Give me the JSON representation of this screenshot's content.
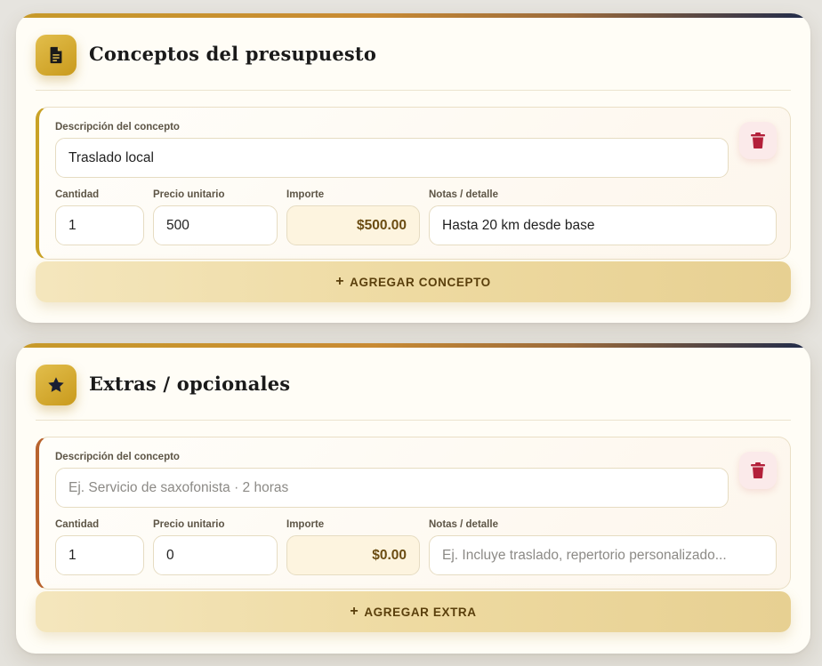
{
  "sections": [
    {
      "title": "Conceptos del presupuesto",
      "icon": "document-icon",
      "item": {
        "desc_label": "Descripción del concepto",
        "desc_value": "Traslado local",
        "desc_placeholder": "",
        "qty_label": "Cantidad",
        "qty_value": "1",
        "price_label": "Precio unitario",
        "price_value": "500",
        "amount_label": "Importe",
        "amount_value": "$500.00",
        "notes_label": "Notas / detalle",
        "notes_value": "Hasta 20 km desde base",
        "notes_placeholder": ""
      },
      "add_button": "AGREGAR CONCEPTO"
    },
    {
      "title": "Extras / opcionales",
      "icon": "star-icon",
      "item": {
        "desc_label": "Descripción del concepto",
        "desc_value": "",
        "desc_placeholder": "Ej. Servicio de saxofonista · 2 horas",
        "qty_label": "Cantidad",
        "qty_value": "1",
        "price_label": "Precio unitario",
        "price_value": "0",
        "amount_label": "Importe",
        "amount_value": "$0.00",
        "notes_label": "Notas / detalle",
        "notes_value": "",
        "notes_placeholder": "Ej. Incluye traslado, repertorio personalizado..."
      },
      "add_button": "AGREGAR EXTRA"
    }
  ],
  "colors": {
    "accent_gold": "#c9a227",
    "accent_copper": "#b8632e",
    "delete_red": "#b3203a",
    "navy": "#1f2a4a"
  }
}
